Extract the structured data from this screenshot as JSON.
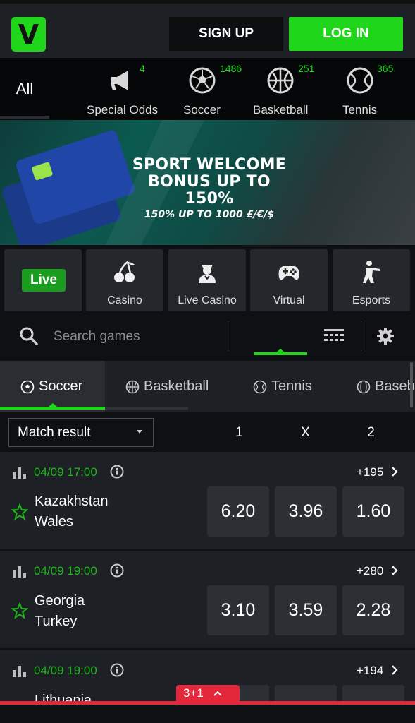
{
  "header": {
    "logo_letter": "V",
    "signup_label": "SIGN UP",
    "login_label": "LOG IN"
  },
  "sportnav": {
    "all_label": "All",
    "items": [
      {
        "label": "Special Odds",
        "count": "4",
        "icon": "megaphone-icon"
      },
      {
        "label": "Soccer",
        "count": "1486",
        "icon": "soccer-ball-icon"
      },
      {
        "label": "Basketball",
        "count": "251",
        "icon": "basketball-icon"
      },
      {
        "label": "Tennis",
        "count": "365",
        "icon": "tennis-ball-icon"
      }
    ]
  },
  "banner": {
    "line1": "SPORT WELCOME",
    "line2": "BONUS UP TO 150%",
    "line3": "150% UP TO 1000 £/€/$"
  },
  "tiles": [
    {
      "label": "",
      "badge": "Live"
    },
    {
      "label": "Casino",
      "icon": "cherries-icon"
    },
    {
      "label": "Live Casino",
      "icon": "dealer-icon"
    },
    {
      "label": "Virtual",
      "icon": "gamepad-icon"
    },
    {
      "label": "Esports",
      "icon": "soldier-icon"
    }
  ],
  "search": {
    "placeholder": "Search games"
  },
  "sporttabs": [
    {
      "label": "Soccer",
      "active": true
    },
    {
      "label": "Basketball"
    },
    {
      "label": "Tennis"
    },
    {
      "label": "Baseb"
    }
  ],
  "market": {
    "selected": "Match result",
    "columns": [
      "1",
      "X",
      "2"
    ]
  },
  "matches": [
    {
      "datetime": "04/09 17:00",
      "more": "+195",
      "home": "Kazakhstan",
      "away": "Wales",
      "odds": [
        "6.20",
        "3.96",
        "1.60"
      ]
    },
    {
      "datetime": "04/09 19:00",
      "more": "+280",
      "home": "Georgia",
      "away": "Turkey",
      "odds": [
        "3.10",
        "3.59",
        "2.28"
      ]
    },
    {
      "datetime": "04/09 19:00",
      "more": "+194",
      "home": "Lithuania",
      "away": "",
      "odds": [
        "",
        "",
        ""
      ]
    }
  ],
  "betslip": {
    "label": "3+1"
  },
  "colors": {
    "accent": "#1fd61a",
    "betslip": "#e3283c",
    "card": "#1d2024",
    "odds_bg": "#2c2f33"
  }
}
